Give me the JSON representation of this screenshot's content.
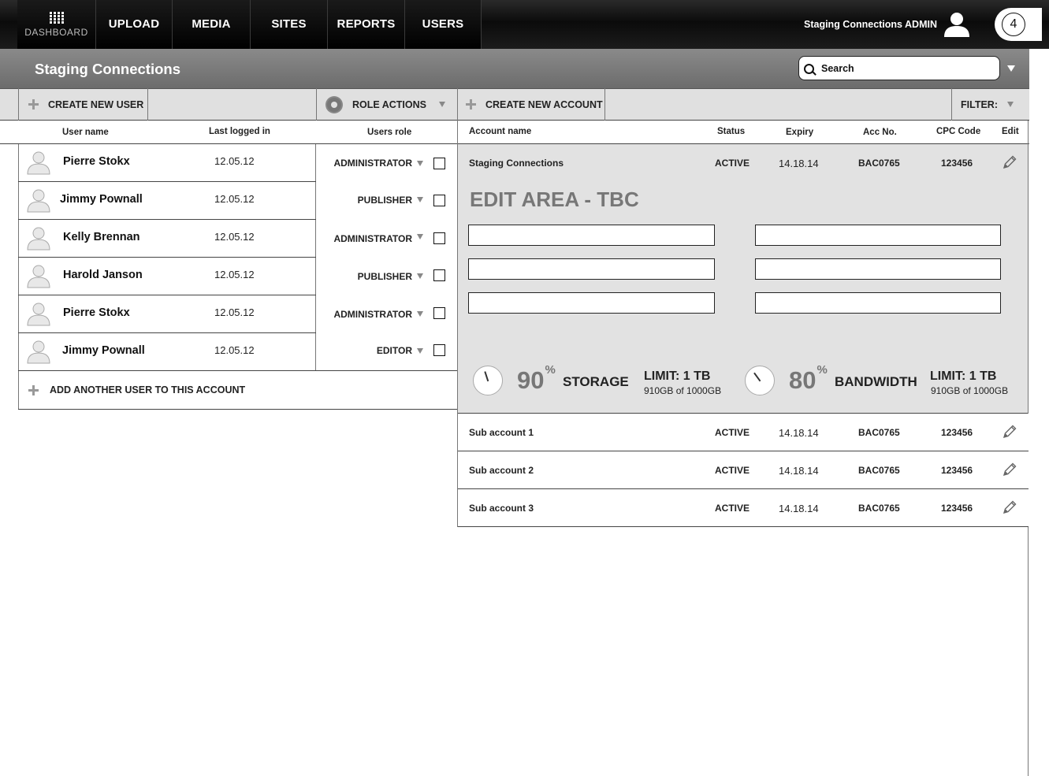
{
  "nav": {
    "dashboard": "DASHBOARD",
    "items": [
      "UPLOAD",
      "MEDIA",
      "SITES",
      "REPORTS",
      "USERS"
    ],
    "admin_name": "Staging Connections ADMIN",
    "notification_count": "4"
  },
  "title_bar": {
    "title": "Staging Connections",
    "search_placeholder": "Search"
  },
  "toolbar": {
    "create_user": "CREATE NEW USER",
    "role_actions": "ROLE ACTIONS",
    "create_account": "CREATE NEW ACCOUNT",
    "filter": "FILTER:"
  },
  "users_table": {
    "headers": {
      "name": "User name",
      "last_logged": "Last logged in",
      "role": "Users role"
    },
    "rows": [
      {
        "name": "Pierre Stokx",
        "last_logged": "12.05.12",
        "role": "ADMINISTRATOR"
      },
      {
        "name": "Jimmy Pownall",
        "last_logged": "12.05.12",
        "role": "PUBLISHER"
      },
      {
        "name": "Kelly Brennan",
        "last_logged": "12.05.12",
        "role": "ADMINISTRATOR"
      },
      {
        "name": "Harold Janson",
        "last_logged": "12.05.12",
        "role": "PUBLISHER"
      },
      {
        "name": "Pierre Stokx",
        "last_logged": "12.05.12",
        "role": "ADMINISTRATOR"
      },
      {
        "name": "Jimmy Pownall",
        "last_logged": "12.05.12",
        "role": "EDITOR"
      }
    ],
    "add_user": "ADD ANOTHER USER TO THIS ACCOUNT"
  },
  "accounts_table": {
    "headers": {
      "account": "Account name",
      "status": "Status",
      "expiry": "Expiry",
      "acc_no": "Acc No.",
      "cpc": "CPC Code",
      "edit": "Edit"
    },
    "main": {
      "name": "Staging Connections",
      "status": "ACTIVE",
      "expiry": "14.18.14",
      "acc_no": "BAC0765",
      "cpc": "123456"
    },
    "edit_area_title": "EDIT AREA - TBC",
    "storage": {
      "percent": 90,
      "percent_text": "90",
      "label": "STORAGE",
      "limit": "LIMIT: 1 TB",
      "usage": "910GB of 1000GB"
    },
    "bandwidth": {
      "percent": 80,
      "percent_text": "80",
      "label": "BANDWIDTH",
      "limit": "LIMIT: 1 TB",
      "usage": "910GB of 1000GB"
    },
    "sub_accounts": [
      {
        "name": "Sub account 1",
        "status": "ACTIVE",
        "expiry": "14.18.14",
        "acc_no": "BAC0765",
        "cpc": "123456"
      },
      {
        "name": "Sub account 2",
        "status": "ACTIVE",
        "expiry": "14.18.14",
        "acc_no": "BAC0765",
        "cpc": "123456"
      },
      {
        "name": "Sub account 3",
        "status": "ACTIVE",
        "expiry": "14.18.14",
        "acc_no": "BAC0765",
        "cpc": "123456"
      }
    ]
  }
}
